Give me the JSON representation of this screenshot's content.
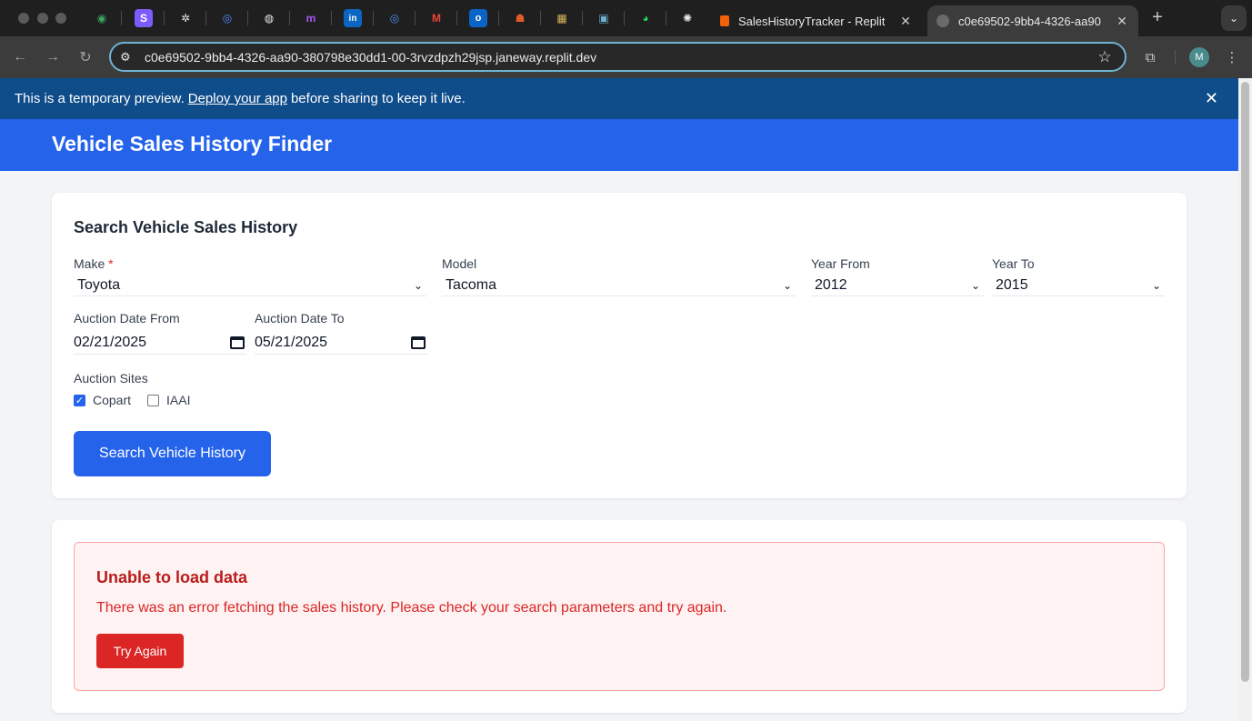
{
  "browser": {
    "tabs": [
      {
        "title": "SalesHistoryTracker - Replit",
        "close": "✕"
      },
      {
        "title": "c0e69502-9bb4-4326-aa90",
        "close": "✕"
      }
    ],
    "address": "c0e69502-9bb4-4326-aa90-380798e30dd1-00-3rvzdpzh29jsp.janeway.replit.dev",
    "profile_initial": "M",
    "pinned_icons": [
      "tab-icon",
      "tab-icon",
      "tab-icon",
      "tab-icon",
      "globe-icon",
      "tab-icon",
      "linkedin-icon",
      "tab-icon",
      "gmail-icon",
      "outlook-icon",
      "tab-icon",
      "tab-icon",
      "tab-icon",
      "whatsapp-icon",
      "openai-icon"
    ]
  },
  "banner": {
    "text_before": "This is a temporary preview.",
    "link": "Deploy your app",
    "text_after": "before sharing to keep it live."
  },
  "header": {
    "title": "Vehicle Sales History Finder"
  },
  "search": {
    "heading": "Search Vehicle Sales History",
    "make_label": "Make",
    "make_required": "*",
    "make_value": "Toyota",
    "model_label": "Model",
    "model_value": "Tacoma",
    "year_from_label": "Year From",
    "year_from_value": "2012",
    "year_to_label": "Year To",
    "year_to_value": "2015",
    "date_from_label": "Auction Date From",
    "date_from_value": "02/21/2025",
    "date_to_label": "Auction Date To",
    "date_to_value": "05/21/2025",
    "sites_label": "Auction Sites",
    "sites": [
      {
        "label": "Copart",
        "checked": true
      },
      {
        "label": "IAAI",
        "checked": false
      }
    ],
    "submit_label": "Search Vehicle History"
  },
  "error": {
    "title": "Unable to load data",
    "message": "There was an error fetching the sales history. Please check your search parameters and try again.",
    "retry_label": "Try Again"
  },
  "colors": {
    "primary": "#2563eb",
    "banner": "#0f4c8a",
    "error": "#dc2626",
    "error_bg": "#fef2f2"
  }
}
